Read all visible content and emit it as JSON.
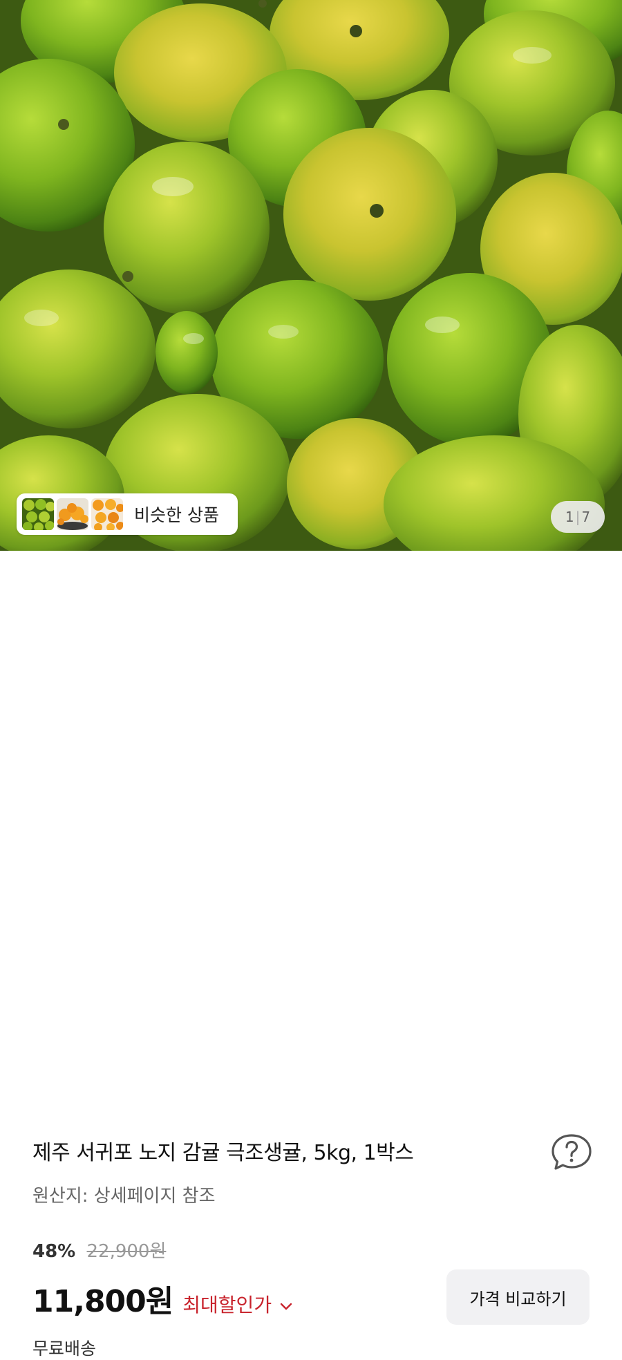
{
  "hero": {
    "image_description": "",
    "similar_products_label": "비슷한 상품",
    "page_current": "1",
    "page_total": "7"
  },
  "product": {
    "title": "제주 서귀포 노지 감귤 극조생귤, 5kg, 1박스",
    "origin": "원산지: 상세페이지 참조",
    "discount_rate": "48%",
    "original_price": "22,900원",
    "price": "11,800원",
    "max_discount_label": "최대할인가",
    "compare_button": "가격 비교하기",
    "shipping": "무료배송"
  },
  "icons": {
    "help": "question-bubble-icon",
    "dropdown": "chevron-down-icon"
  },
  "colors": {
    "accent_red": "#c8232c",
    "button_bg": "#f1f1f3"
  }
}
